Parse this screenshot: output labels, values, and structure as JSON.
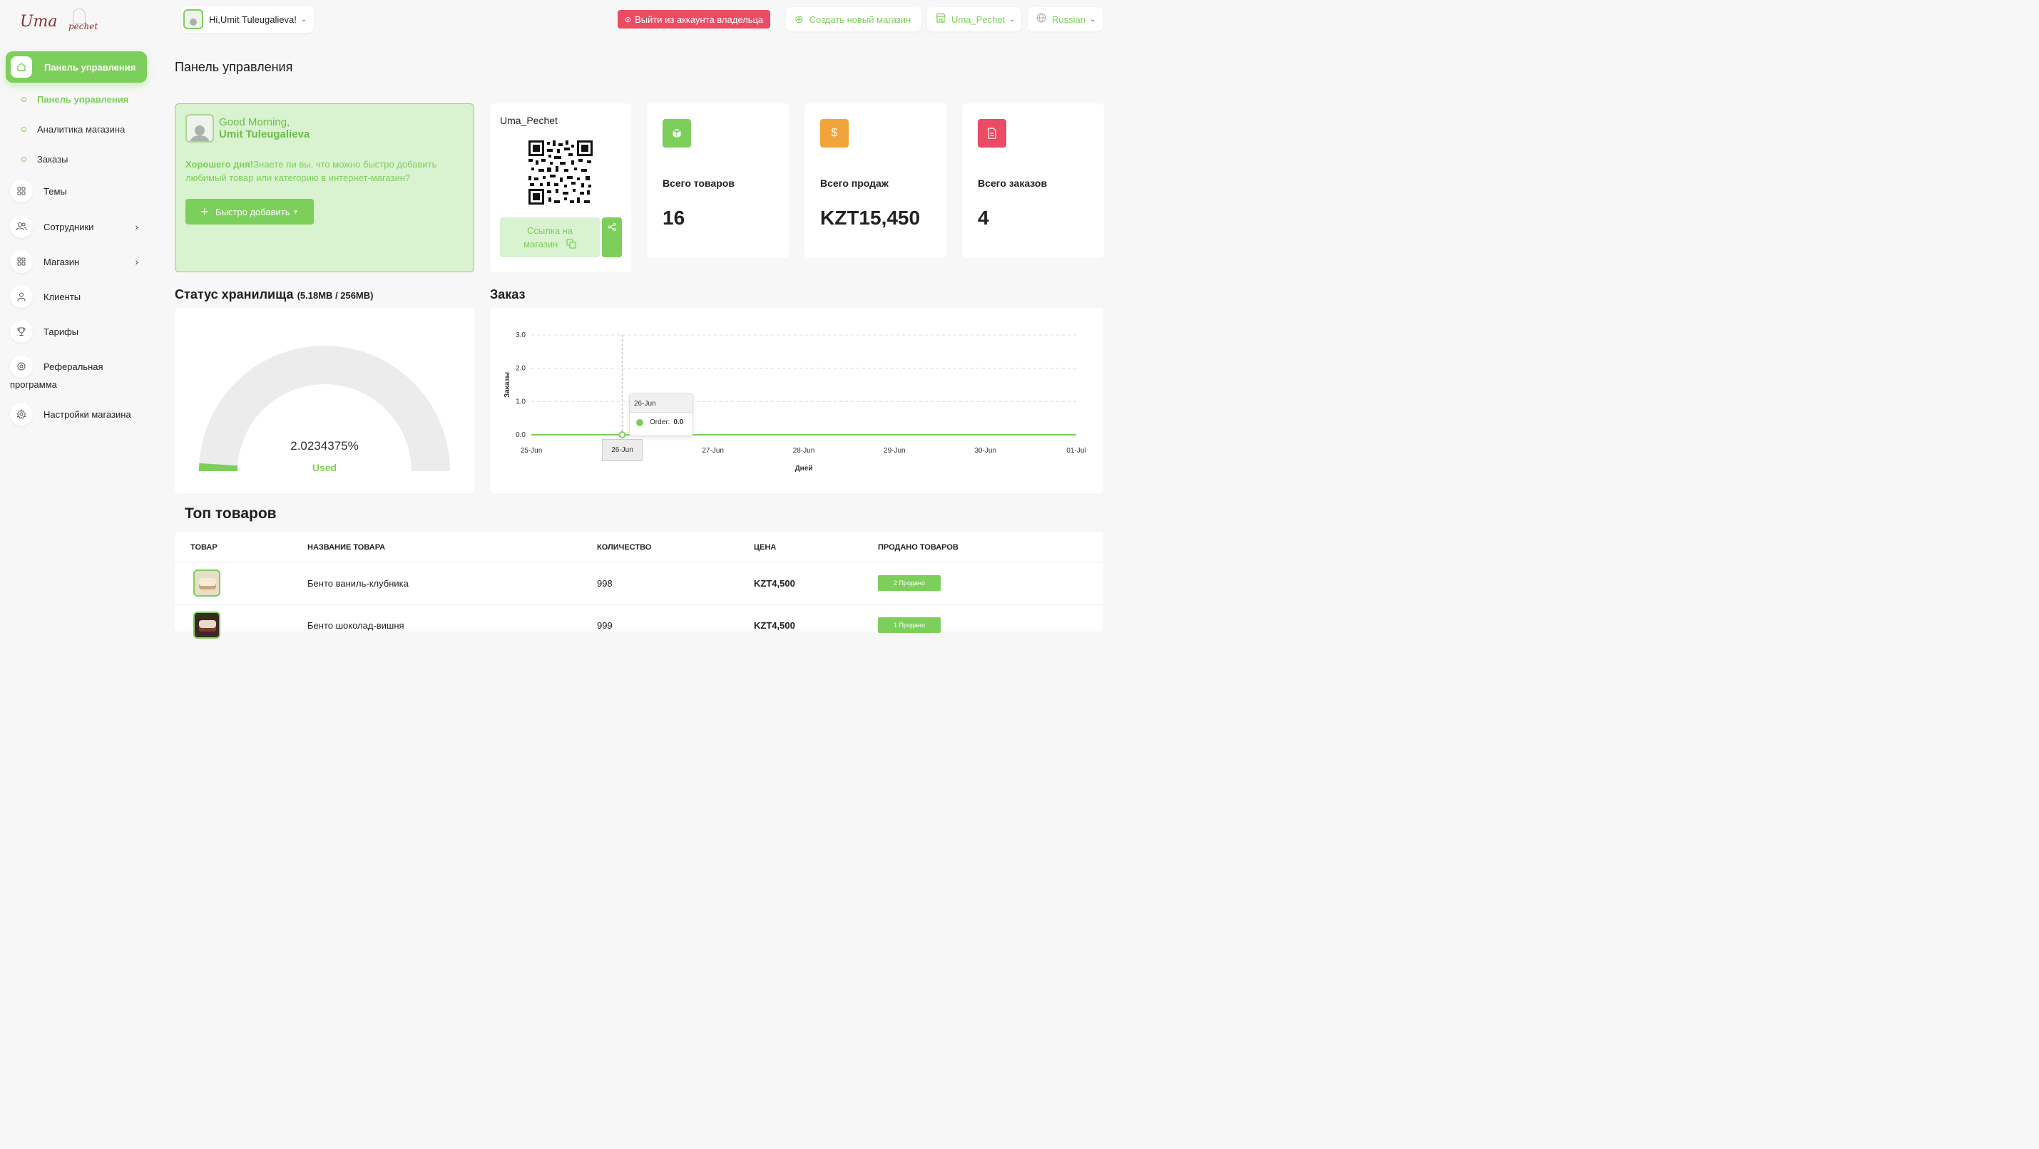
{
  "brand": {
    "main": "Uma",
    "sub": "pechet"
  },
  "sidebar": {
    "active_item": {
      "label": "Панель управления"
    },
    "sub_items": [
      {
        "label": "Панель управления",
        "active": true
      },
      {
        "label": "Аналитика магазина",
        "active": false
      },
      {
        "label": "Заказы",
        "active": false
      }
    ],
    "items": [
      {
        "label": "Темы",
        "icon": "grid-icon",
        "has_chevron": false
      },
      {
        "label": "Сотрудники",
        "icon": "users-icon",
        "has_chevron": true
      },
      {
        "label": "Магазин",
        "icon": "grid-icon",
        "has_chevron": true
      },
      {
        "label": "Клиенты",
        "icon": "user-icon",
        "has_chevron": false
      },
      {
        "label": "Тарифы",
        "icon": "trophy-icon",
        "has_chevron": false
      },
      {
        "label_line1": "Реферальная",
        "label_line2": "программа",
        "icon": "referral-icon",
        "has_chevron": false
      },
      {
        "label": "Настройки магазина",
        "icon": "settings-icon",
        "has_chevron": false
      }
    ]
  },
  "topbar": {
    "greeting": "Hi,Umit Tuleugalieva!",
    "logout": "Выйти из аккаунта владельца",
    "create_store": "Создать новый магазин",
    "store_name": "Uma_Pechet",
    "language": "Russian"
  },
  "page": {
    "title": "Панель управления"
  },
  "welcome": {
    "line1": "Good Morning,",
    "line2": "Umit Tuleugalieva",
    "desc_bold": "Хорошего дня!",
    "desc_rest": "Знаете ли вы, что можно быстро добавить любимый товар или категорию в интернет-магазин?",
    "quick_add": "Быстро добавить"
  },
  "qr_card": {
    "store_name": "Uma_Pechet",
    "link_line1": "Ссылка на",
    "link_line2": "магазин"
  },
  "stats": [
    {
      "label": "Всего товаров",
      "value": "16",
      "icon": "box-icon",
      "color": "#7ccf5a"
    },
    {
      "label": "Всего продаж",
      "value": "KZT15,450",
      "icon": "dollar-icon",
      "color": "#f0a439"
    },
    {
      "label": "Всего заказов",
      "value": "4",
      "icon": "document-icon",
      "color": "#ec4b64"
    }
  ],
  "storage": {
    "title": "Статус хранилища",
    "usage": "(5.18MB / 256MB)",
    "percent_text": "2.0234375%",
    "percent_value": 2.0234375,
    "used_label": "Used"
  },
  "order_section": {
    "title": "Заказ"
  },
  "chart_data": {
    "type": "line",
    "title": "",
    "xlabel": "Дней",
    "ylabel": "Заказы",
    "categories": [
      "25-Jun",
      "26-Jun",
      "27-Jun",
      "28-Jun",
      "29-Jun",
      "30-Jun",
      "01-Jul"
    ],
    "series": [
      {
        "name": "Order",
        "values": [
          0,
          0,
          0,
          0,
          0,
          0,
          0
        ]
      }
    ],
    "y_ticks": [
      "0.0",
      "1.0",
      "2.0",
      "3.0"
    ],
    "ylim": [
      0,
      3
    ],
    "grid": true,
    "color": "#7ccf5a",
    "tooltip": {
      "date": "26-Jun",
      "label": "Order:",
      "value": "0.0"
    },
    "highlight_x": "26-Jun"
  },
  "top_products": {
    "title": "Топ товаров",
    "headers": [
      "ТОВАР",
      "НАЗВАНИЕ ТОВАРА",
      "КОЛИЧЕСТВО",
      "ЦЕНА",
      "ПРОДАНО ТОВАРОВ"
    ],
    "rows": [
      {
        "name": "Бенто ваниль-клубника",
        "qty": "998",
        "price": "KZT4,500",
        "sold": "2 Продано"
      },
      {
        "name": "Бенто шоколад-вишня",
        "qty": "999",
        "price": "KZT4,500",
        "sold": "1 Продано"
      }
    ]
  }
}
